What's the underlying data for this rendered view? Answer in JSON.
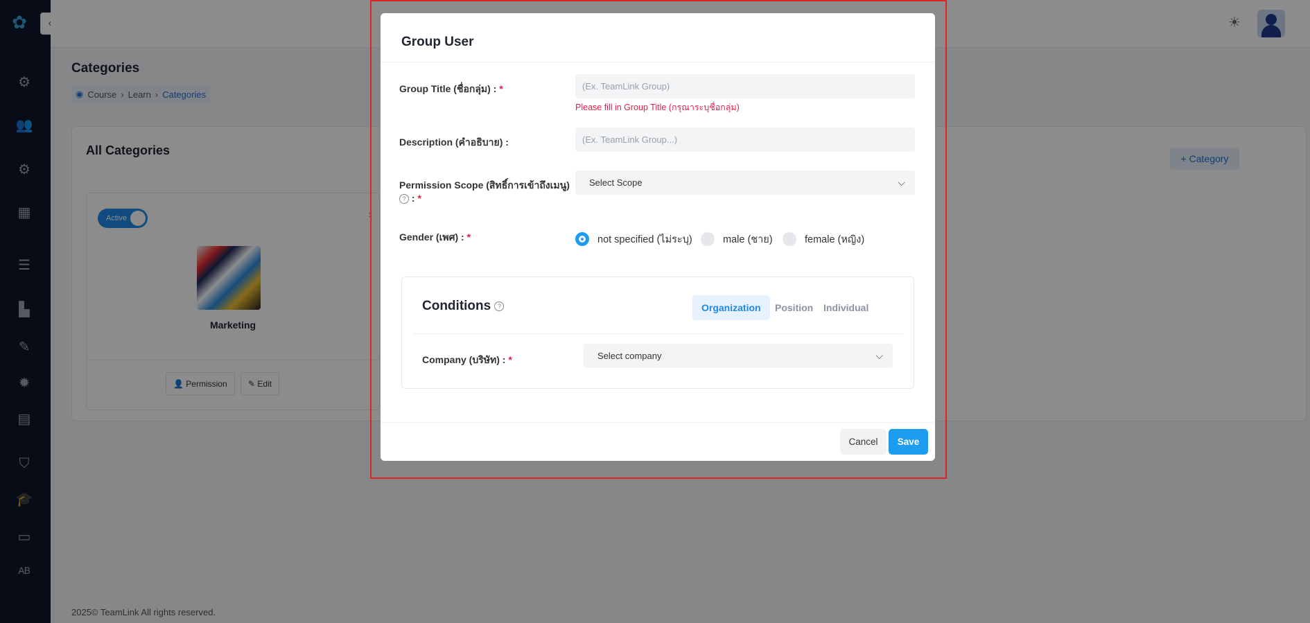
{
  "app": {
    "collapse_icon": "chevron-left",
    "theme_icon": "sun",
    "page_title": "Categories",
    "breadcrumb": [
      "Course",
      "Learn",
      "Categories"
    ],
    "section_title": "All Categories",
    "add_category_label": "Category",
    "category_card": {
      "status_label": "Active",
      "name": "Marketing",
      "permission_label": "Permission",
      "edit_label": "Edit"
    },
    "footer": "2025© TeamLink All rights reserved."
  },
  "modal": {
    "title": "Group User",
    "group_title_label": "Group Title (ชื่อกลุ่ม) :",
    "group_title_placeholder": "(Ex. TeamLink Group)",
    "group_title_error": "Please fill in Group Title (กรุณาระบุชื่อกลุ่ม)",
    "description_label": "Description (คำอธิบาย) :",
    "description_placeholder": "(Ex. TeamLink Group...)",
    "permission_label": "Permission Scope (สิทธิ์การเข้าถึงเมนู)",
    "permission_label_suffix": ":",
    "scope_placeholder": "Select Scope",
    "gender_label": "Gender (เพศ) :",
    "gender_options": [
      "not specified (ไม่ระบุ)",
      "male (ชาย)",
      "female (หญิง)"
    ],
    "gender_selected": "not specified (ไม่ระบุ)",
    "conditions_title": "Conditions",
    "tabs": [
      "Organization",
      "Position",
      "Individual"
    ],
    "active_tab": "Organization",
    "company_label": "Company (บริษัท) :",
    "company_placeholder": "Select company",
    "cancel_label": "Cancel",
    "save_label": "Save",
    "required_mark": "*"
  },
  "colors": {
    "primary": "#1e9cf0",
    "error": "#e11d48",
    "highlight": "#e02424"
  }
}
